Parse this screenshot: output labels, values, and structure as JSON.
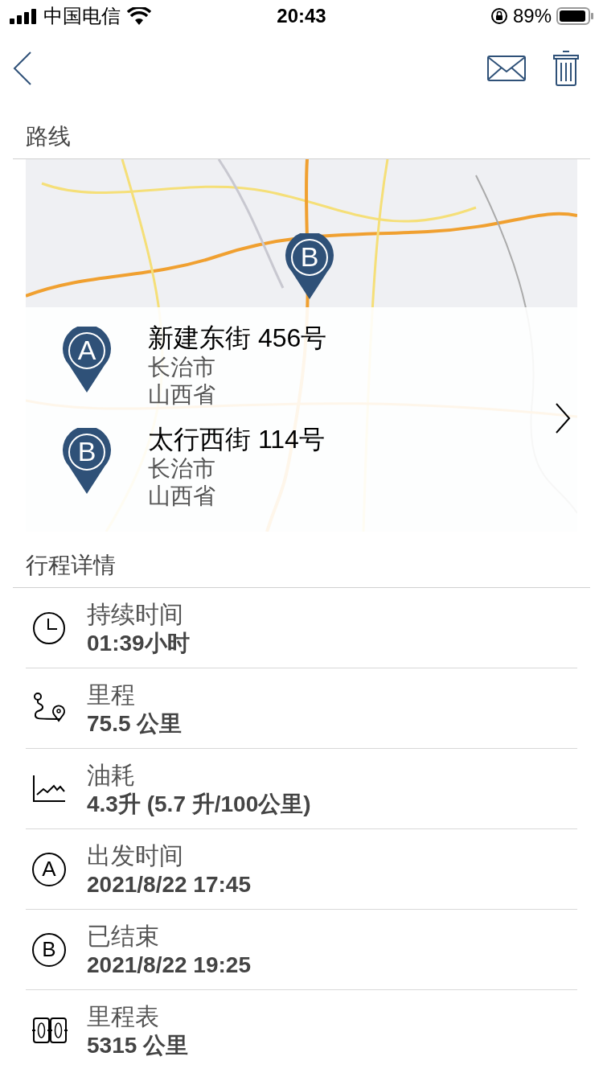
{
  "status_bar": {
    "carrier": "中国电信",
    "time": "20:43",
    "battery": "89%"
  },
  "route_section": {
    "title": "路线",
    "map": {
      "pin": "B"
    },
    "stops": [
      {
        "pin": "A",
        "street": "新建东街 456号",
        "city": "长治市",
        "province": "山西省"
      },
      {
        "pin": "B",
        "street": "太行西街 114号",
        "city": "长治市",
        "province": "山西省"
      }
    ]
  },
  "details_section": {
    "title": "行程详情",
    "rows": [
      {
        "kind": "clock",
        "label": "持续时间",
        "value": "01:39小时"
      },
      {
        "kind": "route",
        "label": "里程",
        "value": "75.5 公里"
      },
      {
        "kind": "chart",
        "label": "油耗",
        "value": "4.3升 (5.7 升/100公里)"
      },
      {
        "kind": "letter",
        "letter": "A",
        "label": "出发时间",
        "value": "2021/8/22 17:45"
      },
      {
        "kind": "letter",
        "letter": "B",
        "label": "已结束",
        "value": "2021/8/22 19:25"
      },
      {
        "kind": "odometer",
        "label": "里程表",
        "value": "5315 公里"
      }
    ]
  }
}
